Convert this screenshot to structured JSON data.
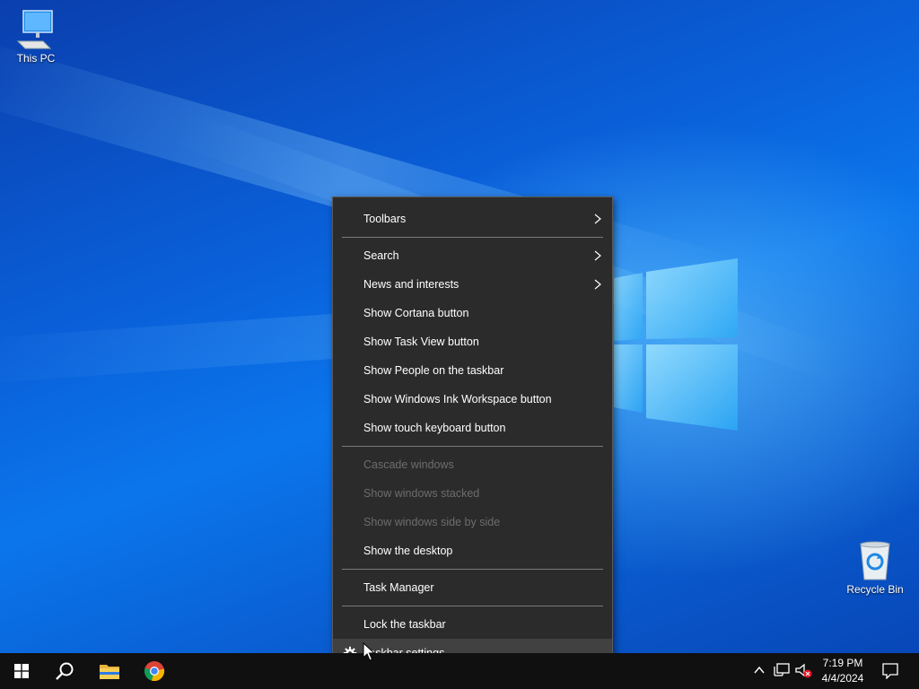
{
  "desktop": {
    "icons": [
      {
        "label": "This PC",
        "icon": "computer-icon"
      },
      {
        "label": "Recycle Bin",
        "icon": "recycle-bin-icon"
      }
    ]
  },
  "context_menu": {
    "items": [
      {
        "label": "Toolbars",
        "submenu": true,
        "enabled": true
      },
      {
        "label": "Search",
        "submenu": true,
        "enabled": true
      },
      {
        "label": "News and interests",
        "submenu": true,
        "enabled": true
      },
      {
        "label": "Show Cortana button",
        "enabled": true
      },
      {
        "label": "Show Task View button",
        "enabled": true
      },
      {
        "label": "Show People on the taskbar",
        "enabled": true
      },
      {
        "label": "Show Windows Ink Workspace button",
        "enabled": true
      },
      {
        "label": "Show touch keyboard button",
        "enabled": true
      },
      {
        "label": "Cascade windows",
        "enabled": false
      },
      {
        "label": "Show windows stacked",
        "enabled": false
      },
      {
        "label": "Show windows side by side",
        "enabled": false
      },
      {
        "label": "Show the desktop",
        "enabled": true
      },
      {
        "label": "Task Manager",
        "enabled": true
      },
      {
        "label": "Lock the taskbar",
        "enabled": true
      },
      {
        "label": "Taskbar settings",
        "enabled": true,
        "icon": "gear-icon",
        "highlighted": true
      }
    ]
  },
  "taskbar": {
    "buttons": [
      {
        "icon": "windows-start-icon"
      },
      {
        "icon": "search-icon"
      },
      {
        "icon": "file-explorer-icon"
      },
      {
        "icon": "chrome-icon"
      }
    ],
    "tray": {
      "icons": [
        "chevron-up-icon",
        "network-icon",
        "volume-muted-icon",
        "notification-icon"
      ],
      "time": "7:19 PM",
      "date": "4/4/2024"
    }
  },
  "colors": {
    "menu_bg": "#2b2b2b",
    "menu_hover": "#414141",
    "disabled_text": "#6d6d6d",
    "taskbar_bg": "#101010"
  }
}
